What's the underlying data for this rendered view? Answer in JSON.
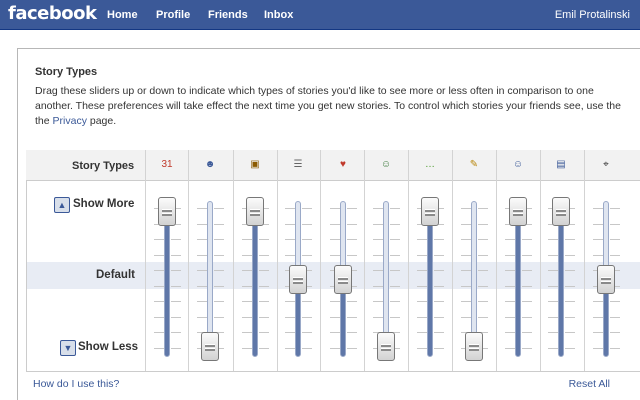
{
  "topbar": {
    "logo": "facebook",
    "nav": [
      "Home",
      "Profile",
      "Friends",
      "Inbox"
    ],
    "user": "Emil Protalinski"
  },
  "panel": {
    "title": "Story Types",
    "description_1": "Drag these sliders up or down to indicate which types of stories you'd like to see more or less often in comparison to one another. These preferences will take effect the next time you get new stories. To control which stories your friends see, use the",
    "privacy_link": "Privacy",
    "description_2": "page."
  },
  "header": {
    "label": "Story Types"
  },
  "rows": {
    "show_more": "Show More",
    "default": "Default",
    "show_less": "Show Less"
  },
  "icons": [
    {
      "name": "calendar-icon",
      "glyph": "31",
      "color": "#c0392b"
    },
    {
      "name": "friends-icon",
      "glyph": "☻",
      "color": "#3b5998"
    },
    {
      "name": "photo-icon",
      "glyph": "▣",
      "color": "#8b5a00"
    },
    {
      "name": "note-icon",
      "glyph": "☰",
      "color": "#666666"
    },
    {
      "name": "heart-icon",
      "glyph": "♥",
      "color": "#c0392b"
    },
    {
      "name": "group-icon",
      "glyph": "☺",
      "color": "#3b7a3b"
    },
    {
      "name": "wall-post-icon",
      "glyph": "…",
      "color": "#4a9a2a"
    },
    {
      "name": "pencil-icon",
      "glyph": "✎",
      "color": "#b8860b"
    },
    {
      "name": "profile-icon",
      "glyph": "☺",
      "color": "#3b5998"
    },
    {
      "name": "page-icon",
      "glyph": "▤",
      "color": "#3b5998"
    },
    {
      "name": "video-icon",
      "glyph": "⌖",
      "color": "#333333"
    }
  ],
  "sliders": [
    1.0,
    0.0,
    1.0,
    0.5,
    0.5,
    0.0,
    1.0,
    0.0,
    1.0,
    1.0,
    0.5
  ],
  "footer": {
    "help": "How do I use this?",
    "reset": "Reset All"
  }
}
